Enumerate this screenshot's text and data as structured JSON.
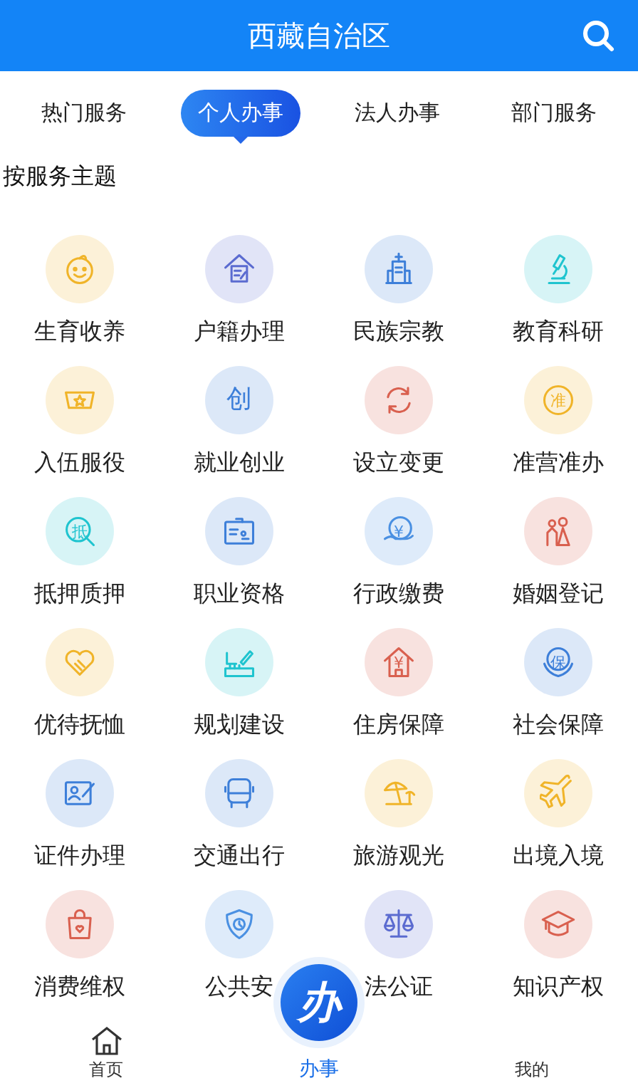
{
  "header": {
    "title": "西藏自治区"
  },
  "tabs": [
    {
      "label": "热门服务",
      "selected": false
    },
    {
      "label": "个人办事",
      "selected": true
    },
    {
      "label": "法人办事",
      "selected": false
    },
    {
      "label": "部门服务",
      "selected": false
    }
  ],
  "section_title": "按服务主题",
  "services": [
    {
      "label": "生育收养",
      "color": "#f0b429"
    },
    {
      "label": "户籍办理",
      "color": "#5b6bd0"
    },
    {
      "label": "民族宗教",
      "color": "#3d7fd9"
    },
    {
      "label": "教育科研",
      "color": "#1fc4cf"
    },
    {
      "label": "入伍服役",
      "color": "#f0b429"
    },
    {
      "label": "就业创业",
      "color": "#3d7fd9",
      "glyph": "创"
    },
    {
      "label": "设立变更",
      "color": "#d9604f"
    },
    {
      "label": "准营准办",
      "color": "#f0b429",
      "glyph": "准"
    },
    {
      "label": "抵押质押",
      "color": "#1fc4cf",
      "glyph": "抵"
    },
    {
      "label": "职业资格",
      "color": "#3d7fd9"
    },
    {
      "label": "行政缴费",
      "color": "#4a90e2",
      "glyph": "¥"
    },
    {
      "label": "婚姻登记",
      "color": "#d9604f"
    },
    {
      "label": "优待抚恤",
      "color": "#f0b429"
    },
    {
      "label": "规划建设",
      "color": "#1fc4cf"
    },
    {
      "label": "住房保障",
      "color": "#d9604f",
      "glyph": "¥"
    },
    {
      "label": "社会保障",
      "color": "#3d7fd9",
      "glyph": "保"
    },
    {
      "label": "证件办理",
      "color": "#3d7fd9"
    },
    {
      "label": "交通出行",
      "color": "#3d7fd9"
    },
    {
      "label": "旅游观光",
      "color": "#f0b429"
    },
    {
      "label": "出境入境",
      "color": "#f0b429"
    },
    {
      "label": "消费维权",
      "color": "#d9604f"
    },
    {
      "label": "公共安",
      "color": "#4a90e2"
    },
    {
      "label": "法公证",
      "color": "#5b6bd0"
    },
    {
      "label": "知识产权",
      "color": "#d9604f"
    }
  ],
  "bottom_nav": [
    {
      "label": "首页",
      "kind": "home",
      "selected": false
    },
    {
      "label": "办事",
      "kind": "center",
      "glyph": "办",
      "selected": true
    },
    {
      "label": "我的",
      "kind": "plain",
      "selected": false
    }
  ]
}
